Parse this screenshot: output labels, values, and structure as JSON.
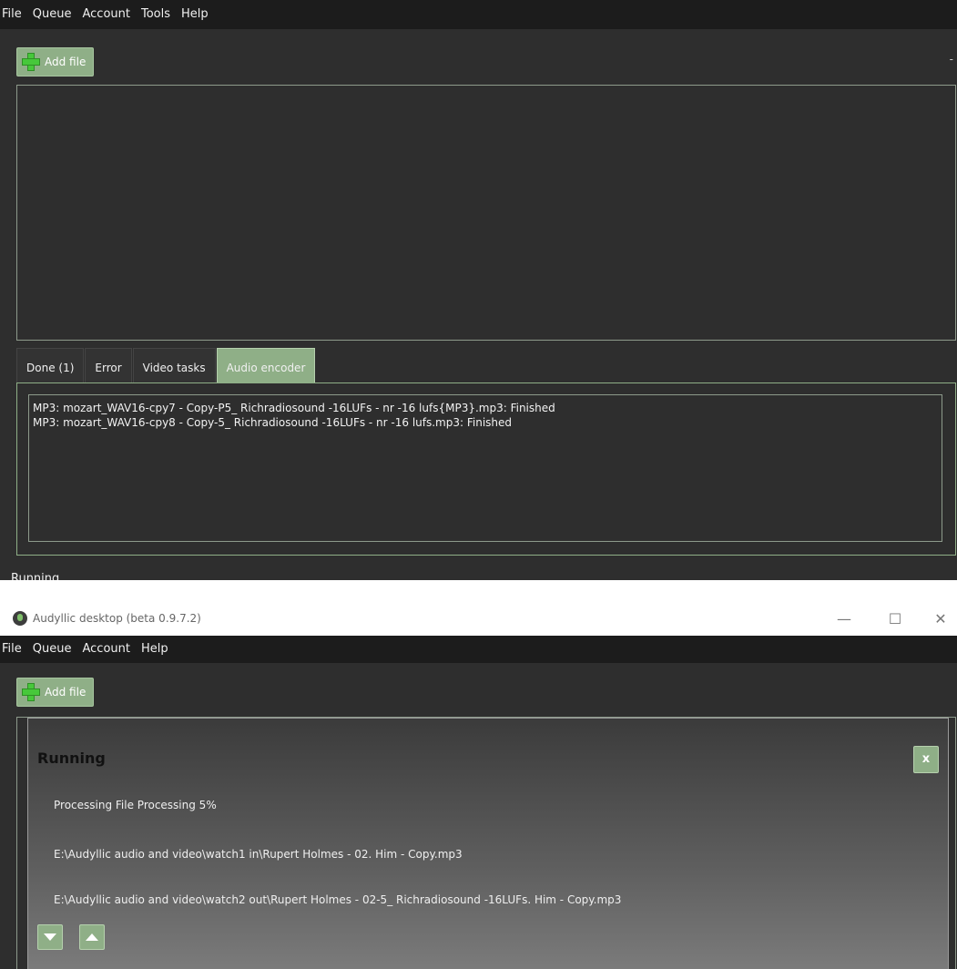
{
  "top": {
    "menu": [
      "File",
      "Queue",
      "Account",
      "Tools",
      "Help"
    ],
    "add_file": "Add file",
    "dash": "-",
    "tabs": [
      "Done (1)",
      "Error",
      "Video tasks",
      "Audio encoder"
    ],
    "log": [
      "MP3: mozart_WAV16-cpy7  - Copy-P5_ Richradiosound -16LUFs - nr -16 lufs{MP3}.mp3: Finished",
      "MP3: mozart_WAV16-cpy8  - Copy-5_ Richradiosound -16LUFs - nr -16 lufs.mp3: Finished"
    ],
    "status": "Running"
  },
  "bottom": {
    "title": "Audyllic desktop (beta 0.9.7.2)",
    "controls": {
      "minimize": "—",
      "maximize": "☐",
      "close": "✕"
    },
    "menu": [
      "File",
      "Queue",
      "Account",
      "Help"
    ],
    "add_file": "Add file",
    "running_title": "Running",
    "close_label": "x",
    "processing": "Processing File Processing 5%",
    "input_path": "E:\\Audyllic audio and video\\watch1 in\\Rupert Holmes - 02. Him - Copy.mp3",
    "output_path": "E:\\Audyllic audio and video\\watch2 out\\Rupert Holmes - 02-5_ Richradiosound -16LUFs. Him - Copy.mp3"
  }
}
